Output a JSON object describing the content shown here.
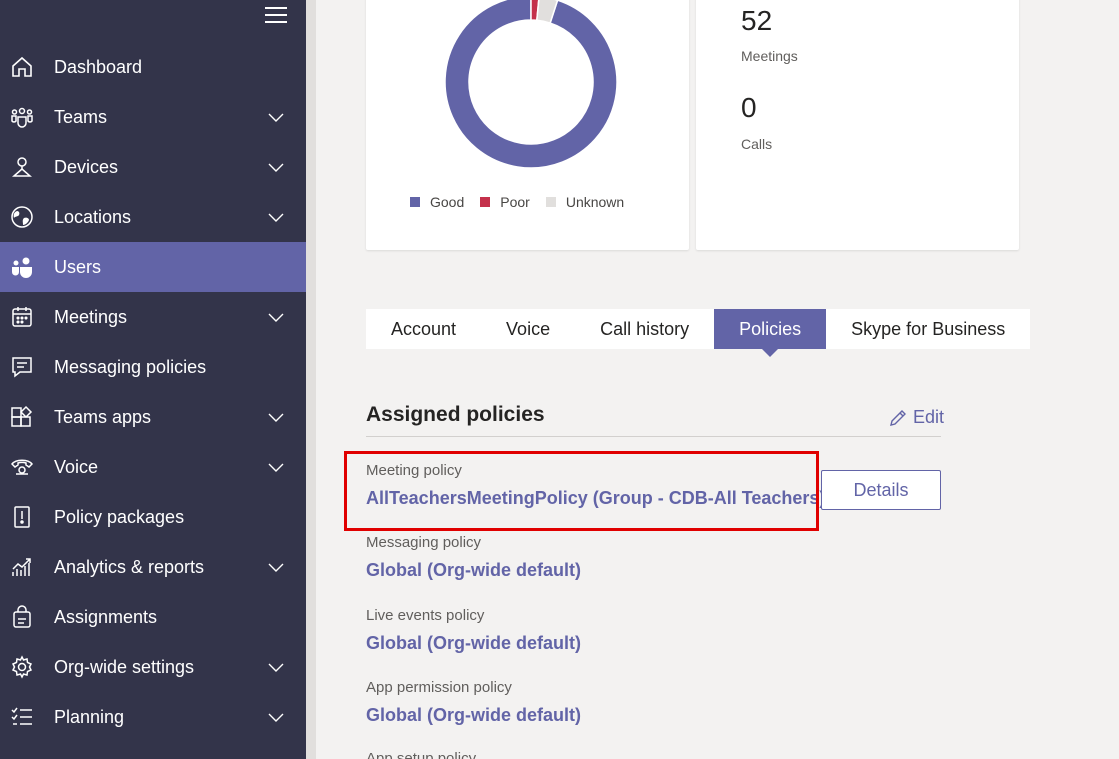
{
  "sidebar": {
    "menu_icon": "hamburger-icon",
    "items": [
      {
        "label": "Dashboard",
        "icon": "home-icon",
        "expandable": false,
        "active": false
      },
      {
        "label": "Teams",
        "icon": "teams-icon",
        "expandable": true,
        "active": false
      },
      {
        "label": "Devices",
        "icon": "devices-icon",
        "expandable": true,
        "active": false
      },
      {
        "label": "Locations",
        "icon": "globe-icon",
        "expandable": true,
        "active": false
      },
      {
        "label": "Users",
        "icon": "users-icon",
        "expandable": false,
        "active": true
      },
      {
        "label": "Meetings",
        "icon": "calendar-icon",
        "expandable": true,
        "active": false
      },
      {
        "label": "Messaging policies",
        "icon": "message-icon",
        "expandable": false,
        "active": false
      },
      {
        "label": "Teams apps",
        "icon": "apps-icon",
        "expandable": true,
        "active": false
      },
      {
        "label": "Voice",
        "icon": "phone-icon",
        "expandable": true,
        "active": false
      },
      {
        "label": "Policy packages",
        "icon": "policy-package-icon",
        "expandable": false,
        "active": false
      },
      {
        "label": "Analytics & reports",
        "icon": "analytics-icon",
        "expandable": true,
        "active": false
      },
      {
        "label": "Assignments",
        "icon": "assignments-icon",
        "expandable": false,
        "active": false
      },
      {
        "label": "Org-wide settings",
        "icon": "gear-icon",
        "expandable": true,
        "active": false
      },
      {
        "label": "Planning",
        "icon": "checklist-icon",
        "expandable": true,
        "active": false
      }
    ]
  },
  "call_quality": {
    "legend": [
      {
        "label": "Good",
        "color": "#6264a7"
      },
      {
        "label": "Poor",
        "color": "#c4314b"
      },
      {
        "label": "Unknown",
        "color": "#e1dfdd"
      }
    ]
  },
  "chart_data": {
    "type": "pie",
    "categories": [
      "Good",
      "Poor",
      "Unknown"
    ],
    "values": [
      95,
      1.5,
      3.5
    ],
    "colors": [
      "#6264a7",
      "#c4314b",
      "#e1dfdd"
    ],
    "donut": true
  },
  "stats": {
    "meetings_value": "52",
    "meetings_label": "Meetings",
    "calls_value": "0",
    "calls_label": "Calls"
  },
  "tabs": [
    {
      "label": "Account",
      "active": false
    },
    {
      "label": "Voice",
      "active": false
    },
    {
      "label": "Call history",
      "active": false
    },
    {
      "label": "Policies",
      "active": true
    },
    {
      "label": "Skype for Business",
      "active": false
    }
  ],
  "assigned": {
    "title": "Assigned policies",
    "edit_label": "Edit",
    "details_label": "Details",
    "policies": [
      {
        "label": "Meeting policy",
        "value": "AllTeachersMeetingPolicy (Group - CDB-All Teachers)"
      },
      {
        "label": "Messaging policy",
        "value": "Global (Org-wide default)"
      },
      {
        "label": "Live events policy",
        "value": "Global (Org-wide default)"
      },
      {
        "label": "App permission policy",
        "value": "Global (Org-wide default)"
      },
      {
        "label": "App setup policy",
        "value": ""
      }
    ]
  },
  "colors": {
    "sidebar_bg": "#33344a",
    "accent": "#6264a7",
    "highlight": "#e00000"
  }
}
